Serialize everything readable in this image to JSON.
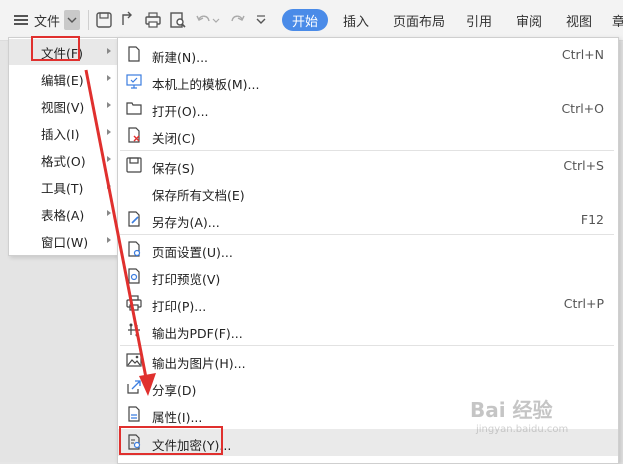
{
  "toolbar": {
    "file_label": "文件",
    "tabs": [
      "开始",
      "插入",
      "页面布局",
      "引用",
      "审阅",
      "视图",
      "章"
    ]
  },
  "menu_l1": [
    {
      "label": "文件(F)"
    },
    {
      "label": "编辑(E)"
    },
    {
      "label": "视图(V)"
    },
    {
      "label": "插入(I)"
    },
    {
      "label": "格式(O)"
    },
    {
      "label": "工具(T)"
    },
    {
      "label": "表格(A)"
    },
    {
      "label": "窗口(W)"
    }
  ],
  "menu_l2": [
    {
      "label": "新建(N)...",
      "shortcut": "Ctrl+N",
      "icon": "new-doc-icon"
    },
    {
      "label": "本机上的模板(M)...",
      "shortcut": "",
      "icon": "template-icon"
    },
    {
      "label": "打开(O)...",
      "shortcut": "Ctrl+O",
      "icon": "folder-icon"
    },
    {
      "label": "关闭(C)",
      "shortcut": "",
      "icon": "close-doc-icon"
    },
    {
      "label": "保存(S)",
      "shortcut": "Ctrl+S",
      "icon": "save-icon"
    },
    {
      "label": "保存所有文档(E)",
      "shortcut": "",
      "icon": ""
    },
    {
      "label": "另存为(A)...",
      "shortcut": "F12",
      "icon": "save-as-icon"
    },
    {
      "label": "页面设置(U)...",
      "shortcut": "",
      "icon": "page-setup-icon"
    },
    {
      "label": "打印预览(V)",
      "shortcut": "",
      "icon": "print-preview-icon"
    },
    {
      "label": "打印(P)...",
      "shortcut": "Ctrl+P",
      "icon": "print-icon"
    },
    {
      "label": "输出为PDF(F)...",
      "shortcut": "",
      "icon": "pdf-export-icon"
    },
    {
      "label": "输出为图片(H)...",
      "shortcut": "",
      "icon": "image-export-icon"
    },
    {
      "label": "分享(D)",
      "shortcut": "",
      "icon": "share-icon"
    },
    {
      "label": "属性(I)...",
      "shortcut": "",
      "icon": "properties-icon"
    },
    {
      "label": "文件加密(Y)...",
      "shortcut": "",
      "icon": "encrypt-icon"
    }
  ],
  "colors": {
    "accent": "#4a8be8",
    "annotation": "#e0302e"
  },
  "watermark": {
    "main": "Bai 经验",
    "sub": "jingyan.baidu.com"
  }
}
